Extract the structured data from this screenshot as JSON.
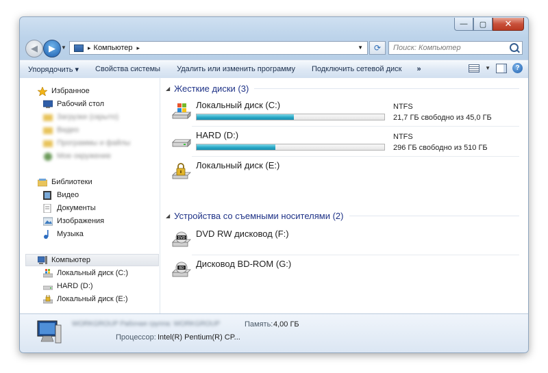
{
  "window": {
    "caption": {
      "minimize": "—",
      "maximize": "▢",
      "close": "✕"
    }
  },
  "nav": {
    "breadcrumb": "Компьютер",
    "crumb_sep": "▸",
    "search_placeholder": "Поиск: Компьютер"
  },
  "toolbar": {
    "organize": "Упорядочить ▾",
    "system_properties": "Свойства системы",
    "uninstall": "Удалить или изменить программу",
    "map_drive": "Подключить сетевой диск",
    "more": "»",
    "help": "?"
  },
  "sidebar": {
    "favorites": {
      "title": "Избранное",
      "items": [
        "Рабочий стол",
        "Загрузки (скрыто)",
        "Видео",
        "Программы и файлы",
        "Мое окружение"
      ]
    },
    "libraries": {
      "title": "Библиотеки",
      "items": [
        "Видео",
        "Документы",
        "Изображения",
        "Музыка"
      ]
    },
    "computer": {
      "title": "Компьютер",
      "items": [
        "Локальный диск (C:)",
        "HARD (D:)",
        "Локальный диск (E:)"
      ]
    }
  },
  "groups": [
    {
      "title": "Жесткие диски (3)",
      "drives": [
        {
          "name": "Локальный диск (C:)",
          "fs": "NTFS",
          "free_text": "21,7 ГБ свободно из 45,0 ГБ",
          "used_fraction": 0.518,
          "icon": "windows-drive-icon"
        },
        {
          "name": "HARD (D:)",
          "fs": "NTFS",
          "free_text": "296 ГБ свободно из 510 ГБ",
          "used_fraction": 0.42,
          "icon": "hard-drive-icon"
        },
        {
          "name": "Локальный диск (E:)",
          "icon": "locked-drive-icon"
        }
      ]
    },
    {
      "title": "Устройства со съемными носителями (2)",
      "drives": [
        {
          "name": "DVD RW дисковод (F:)",
          "icon": "dvd-drive-icon"
        },
        {
          "name": "Дисковод BD-ROM (G:)",
          "icon": "bd-drive-icon"
        }
      ]
    }
  ],
  "status": {
    "blur_line": "WORKGROUP    Рабочая группа:    WORKGROUP",
    "memory_label": "Память:",
    "memory_value": "4,00 ГБ",
    "cpu_label": "Процессор:",
    "cpu_value": "Intel(R) Pentium(R) CP..."
  },
  "colors": {
    "accent": "#1e3287",
    "bar_fill": "#28a7c5"
  }
}
